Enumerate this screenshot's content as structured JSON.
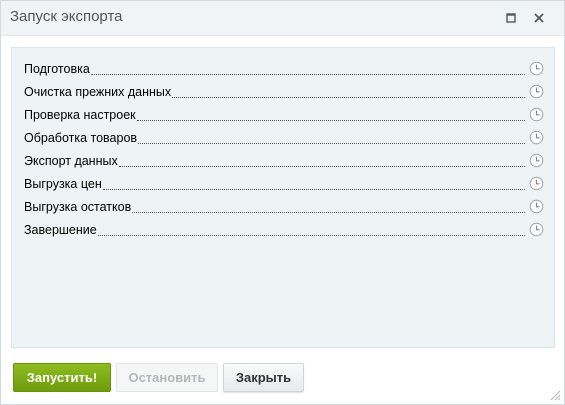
{
  "dialog": {
    "title": "Запуск экспорта"
  },
  "steps": [
    {
      "label": "Подготовка",
      "icon": "clock-icon"
    },
    {
      "label": "Очистка прежних данных",
      "icon": "clock-icon"
    },
    {
      "label": "Проверка настроек",
      "icon": "clock-icon"
    },
    {
      "label": "Обработка товаров",
      "icon": "clock-icon"
    },
    {
      "label": "Экспорт данных",
      "icon": "clock-icon"
    },
    {
      "label": "Выгрузка цен",
      "icon": "clock-icon"
    },
    {
      "label": "Выгрузка остатков",
      "icon": "clock-icon"
    },
    {
      "label": "Завершение",
      "icon": "clock-icon"
    }
  ],
  "buttons": {
    "start": "Запустить!",
    "stop": "Остановить",
    "close": "Закрыть"
  },
  "colors": {
    "start_button": "#7aa712",
    "panel_background": "#eef3f5",
    "titlebar_background": "#f1f4f4",
    "disabled_text": "#b3b8ba"
  }
}
